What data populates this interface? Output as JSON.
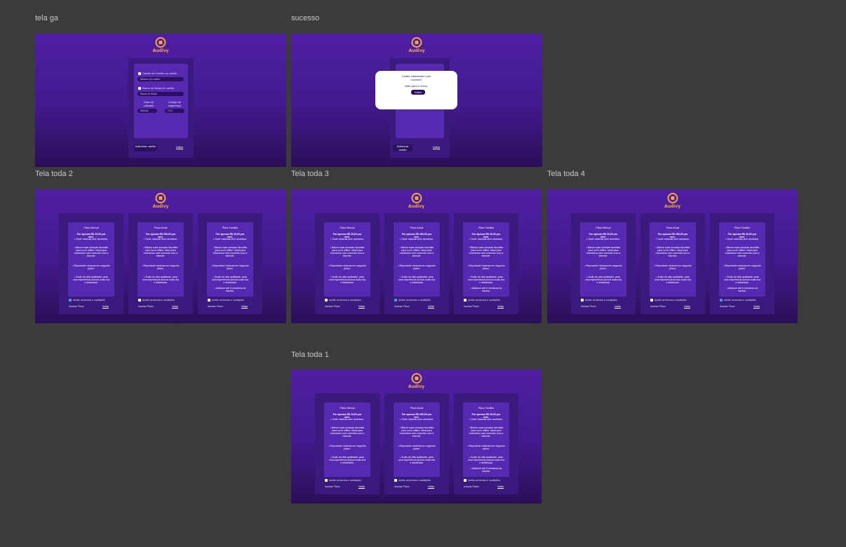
{
  "frames": {
    "tela_ga": {
      "label": "tela ga",
      "logo": "Audivy",
      "card_type_label": "Cartão de Crédito ou débito",
      "card_number_placeholder": "Número do cartão",
      "holder_label": "Nome do titular do cartão",
      "holder_placeholder": "Nome do titular",
      "expiry_label": "Data de validade",
      "expiry_placeholder": "MM/AA",
      "cvc_label": "Código de segurança",
      "cvc_placeholder": "CVC",
      "add_button": "Adicionar cartão",
      "back_button": "Voltar"
    },
    "sucesso": {
      "label": "sucesso",
      "logo": "Audivy",
      "message": "Cartão cadastrado com sucesso!",
      "sub": "Volte para o menu.",
      "button": "Voltar",
      "add_button": "Adicionar cartão",
      "back_button": "Voltar"
    },
    "tela_toda_2": {
      "label": "Tela toda 2"
    },
    "tela_toda_3": {
      "label": "Tela toda 3"
    },
    "tela_toda_4": {
      "label": "Tela toda 4"
    },
    "tela_toda_1": {
      "label": "Tela toda 1"
    }
  },
  "plans": [
    {
      "name": "Plano Mensal",
      "price": "Por apenas R$ 29,90 por mês.",
      "f1": "• Ouvir músicas sem anúncios.",
      "f2": "• Baixar suas músicas favoritas para ouvir offline. Ideal para momentos sem conexão com a internet.",
      "f3": "• Reproduzir músicas em segundo plano.",
      "f4": "• Áudio de alta qualidade, para uma experiência sonora mais rica e detalhada.",
      "f5": ""
    },
    {
      "name": "Plano Anual",
      "price": "Por apenas R$ 289,90 por ano.",
      "f1": "• Ouvir músicas sem anúncios.",
      "f2": "• Baixar suas músicas favoritas para ouvir offline. Ideal para momentos sem conexão com a internet.",
      "f3": "• Reproduzir músicas em segundo plano.",
      "f4": "• Áudio de alta qualidade, para uma experiência sonora mais rica e detalhada.",
      "f5": ""
    },
    {
      "name": "Plano Familiar",
      "price": "Por apenas R$ 49,90 por mês.",
      "f1": "• Ouvir músicas sem anúncios.",
      "f2": "• Baixar suas músicas favoritas para ouvir offline. Ideal para momentos sem conexão com a internet.",
      "f3": "• Reproduzir músicas em segundo plano.",
      "f4": "• Áudio de alta qualidade, para uma experiência sonora mais rica e detalhada.",
      "f5": "• Adicione até 5 membros da família."
    }
  ],
  "common": {
    "logo": "Audivy",
    "terms": "Aceito os termos e condições",
    "subscribe": "Assinar Plano",
    "back": "Voltar"
  },
  "colors": {
    "canvas": "#3b3b3b",
    "frame_top": "#4e1fa3",
    "frame_bottom": "#2a0f57",
    "logo": "#f4a83a",
    "checked": "#5a8ff0"
  }
}
